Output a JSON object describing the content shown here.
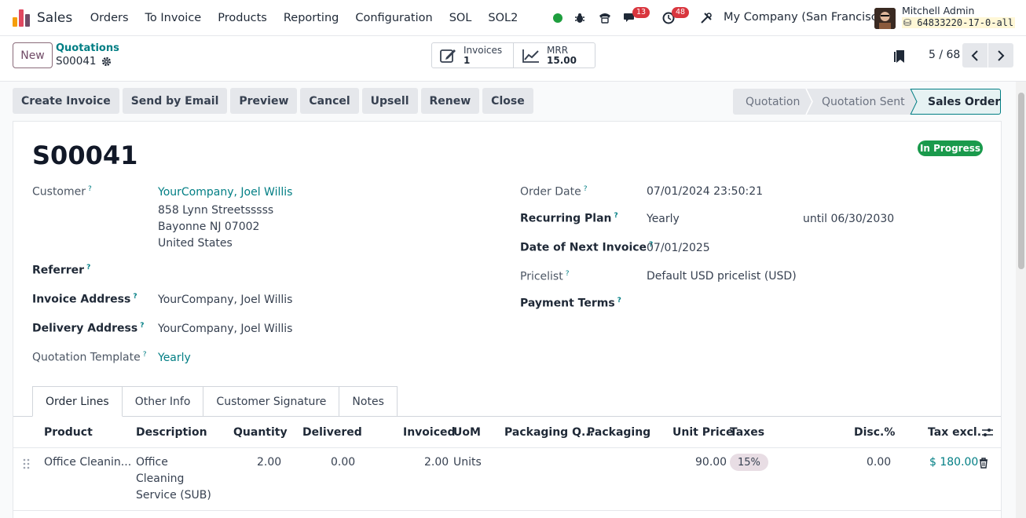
{
  "navbar": {
    "app_title": "Sales",
    "menu": [
      "Orders",
      "To Invoice",
      "Products",
      "Reporting",
      "Configuration",
      "SOL",
      "SOL2"
    ],
    "messages_count": "13",
    "activities_count": "48",
    "company": "My Company (San Francisco)",
    "user_name": "Mitchell Admin",
    "db_name": "64833220-17-0-all"
  },
  "control": {
    "new_label": "New",
    "breadcrumb_parent": "Quotations",
    "breadcrumb_current": "S00041",
    "smart_buttons": [
      {
        "label": "Invoices",
        "value": "1",
        "icon": "pencil-square-icon"
      },
      {
        "label": "MRR",
        "value": "15.00",
        "icon": "line-chart-icon"
      }
    ],
    "pager": "5 / 68"
  },
  "actions": [
    "Create Invoice",
    "Send by Email",
    "Preview",
    "Cancel",
    "Upsell",
    "Renew",
    "Close"
  ],
  "status_stages": [
    "Quotation",
    "Quotation Sent",
    "Sales Order"
  ],
  "active_stage": "Sales Order",
  "form": {
    "title": "S00041",
    "status_badge": "In Progress",
    "customer_label": "Customer",
    "customer_name": "YourCompany, Joel Willis",
    "customer_address": [
      "858 Lynn Streetsssss",
      "Bayonne NJ 07002",
      "United States"
    ],
    "referrer_label": "Referrer",
    "invoice_address_label": "Invoice Address",
    "invoice_address": "YourCompany, Joel Willis",
    "delivery_address_label": "Delivery Address",
    "delivery_address": "YourCompany, Joel Willis",
    "quotation_template_label": "Quotation Template",
    "quotation_template": "Yearly",
    "order_date_label": "Order Date",
    "order_date": "07/01/2024 23:50:21",
    "recurring_plan_label": "Recurring Plan",
    "recurring_plan": "Yearly",
    "recurring_until": "until 06/30/2030",
    "next_invoice_label": "Date of Next Invoice",
    "next_invoice": "07/01/2025",
    "pricelist_label": "Pricelist",
    "pricelist": "Default USD pricelist (USD)",
    "payment_terms_label": "Payment Terms"
  },
  "tabs": [
    "Order Lines",
    "Other Info",
    "Customer Signature",
    "Notes"
  ],
  "table": {
    "headers": [
      "Product",
      "Description",
      "Quantity",
      "Delivered",
      "Invoiced",
      "UoM",
      "Packaging Q...",
      "Packaging",
      "Unit Price",
      "Taxes",
      "Disc.%",
      "Tax excl."
    ],
    "rows": [
      {
        "product": "Office Cleanin...",
        "description": [
          "Office",
          "Cleaning",
          "Service (SUB)"
        ],
        "quantity": "2.00",
        "delivered": "0.00",
        "invoiced": "2.00",
        "uom": "Units",
        "unit_price": "90.00",
        "tax": "15%",
        "discount": "0.00",
        "subtotal": "$ 180.00"
      }
    ]
  },
  "colors": {
    "brand": "#714B67",
    "link": "#017e84",
    "success": "#1a9a4c",
    "danger": "#d9363e"
  }
}
